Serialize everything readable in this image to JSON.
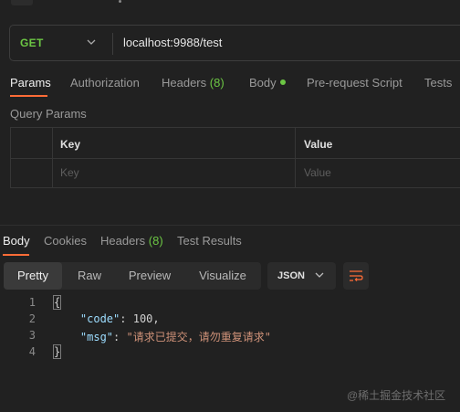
{
  "request": {
    "method": "GET",
    "url": "localhost:9988/test"
  },
  "request_tabs": {
    "params": "Params",
    "authorization": "Authorization",
    "headers": "Headers",
    "headers_count": "(8)",
    "body": "Body",
    "pre_request": "Pre-request Script",
    "tests": "Tests"
  },
  "query_params": {
    "title": "Query Params",
    "col_key": "Key",
    "col_value": "Value",
    "key_placeholder": "Key",
    "value_placeholder": "Value"
  },
  "response_tabs": {
    "body": "Body",
    "cookies": "Cookies",
    "headers": "Headers",
    "headers_count": "(8)",
    "test_results": "Test Results"
  },
  "view_modes": {
    "pretty": "Pretty",
    "raw": "Raw",
    "preview": "Preview",
    "visualize": "Visualize",
    "format": "JSON"
  },
  "response_body": {
    "line_numbers": [
      "1",
      "2",
      "3",
      "4"
    ],
    "open_brace": "{",
    "close_brace": "}",
    "key1": "\"code\"",
    "value1": "100",
    "key2": "\"msg\"",
    "value2": "\"请求已提交，请勿重复请求\""
  },
  "watermark": "@稀土掘金技术社区",
  "colors": {
    "accent": "#ff6c37",
    "get_method": "#6cc644",
    "background": "#212121"
  },
  "icons": [
    "back-arrow-icon",
    "chevron-down-icon",
    "wrap-lines-icon"
  ]
}
